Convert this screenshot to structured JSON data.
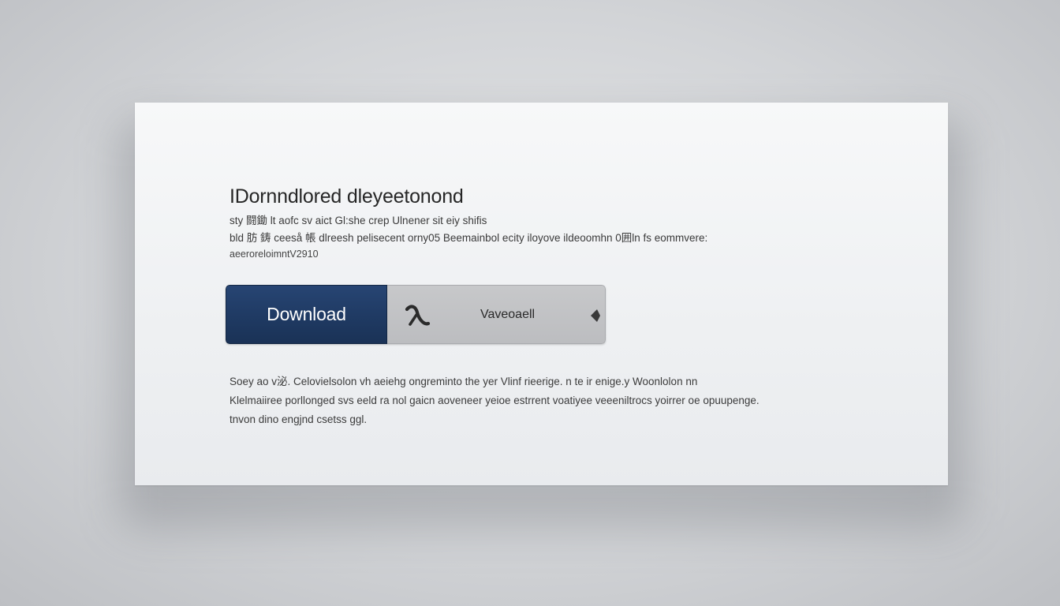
{
  "dialog": {
    "title": "IDornndlored dleyeetonond",
    "description": [
      "sty 闘鋤 lt aofc sv aict Gl:she crep Ulnener sit eiy shifis",
      "bld 肪 鋳 ceeså 帳 dlreesh pelisecent orny05 Beemainbol ecity iloyove ildeoomhn 0囲ln fs eommvere:",
      "aeeroreloimntV2910"
    ],
    "download_button": {
      "label": "Download"
    },
    "secondary_button": {
      "label": "Vaveoaell"
    },
    "footer": [
      "Soey ao v泌. Celovielsolon vh aeiehg ongreminto the yer Vlinf rieerige. n te ir enige.y Woonlolon nn",
      "Klelmaiiree porllonged svs eeld ra nol gaicn aoveneer yeioe estrrent voatiyee veeeniltrocs yoirrer oe opuupenge.",
      "tnvon dino engjnd csetss ggl."
    ]
  },
  "colors": {
    "primary_button": "#1f3a63",
    "secondary_button": "#bfc0c3",
    "card_background": "#f3f4f6",
    "page_background": "#d2d4d7"
  },
  "icons": {
    "secondary_left": "swoosh-icon",
    "secondary_right": "caret-diamond-icon"
  }
}
